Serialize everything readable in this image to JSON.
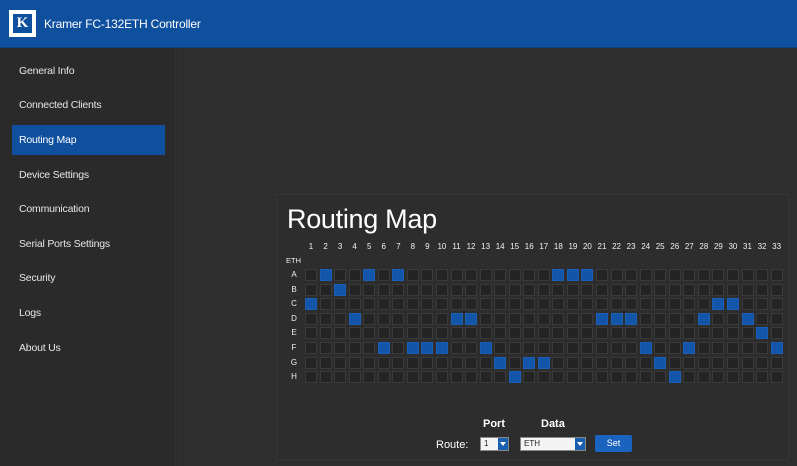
{
  "header": {
    "title": "Kramer FC-132ETH Controller",
    "logo_letter": "K"
  },
  "sidebar": {
    "items": [
      {
        "label": "General Info"
      },
      {
        "label": "Connected Clients"
      },
      {
        "label": "Routing Map",
        "active": true
      },
      {
        "label": "Device Settings"
      },
      {
        "label": "Communication"
      },
      {
        "label": "Serial Ports Settings"
      },
      {
        "label": "Security"
      },
      {
        "label": "Logs"
      },
      {
        "label": "About Us"
      }
    ]
  },
  "routing": {
    "title": "Routing Map",
    "eth_label": "ETH",
    "columns": [
      "1",
      "2",
      "3",
      "4",
      "5",
      "6",
      "7",
      "8",
      "9",
      "10",
      "11",
      "12",
      "13",
      "14",
      "15",
      "16",
      "17",
      "18",
      "19",
      "20",
      "21",
      "22",
      "23",
      "24",
      "25",
      "26",
      "27",
      "28",
      "29",
      "30",
      "31",
      "32",
      "33"
    ],
    "rows": [
      "A",
      "B",
      "C",
      "D",
      "E",
      "F",
      "G",
      "H"
    ],
    "active_cells": {
      "A": [
        2,
        5,
        7,
        18,
        19,
        20
      ],
      "B": [
        3
      ],
      "C": [
        1,
        29,
        30
      ],
      "D": [
        4,
        11,
        12,
        21,
        22,
        23,
        28,
        31
      ],
      "E": [
        32
      ],
      "F": [
        6,
        8,
        9,
        10,
        13,
        24,
        27,
        33
      ],
      "G": [
        14,
        16,
        17,
        25
      ],
      "H": [
        15,
        26
      ]
    }
  },
  "controls": {
    "port_label": "Port",
    "data_label": "Data",
    "route_label": "Route:",
    "port_value": "1",
    "data_value": "ETH",
    "set_label": "Set"
  }
}
